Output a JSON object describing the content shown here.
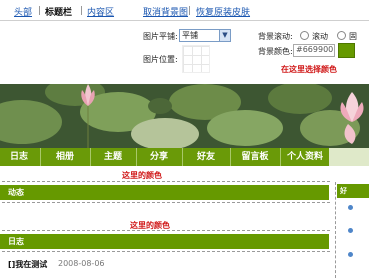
{
  "tabs": [
    {
      "label": "头部"
    },
    {
      "label": "标题栏"
    },
    {
      "label": "内容区"
    }
  ],
  "actions": {
    "cancel_bg": "取消背景图",
    "restore_skin": "恢复原装皮肤"
  },
  "settings": {
    "tile_label": "图片平铺:",
    "tile_value": "平铺",
    "position_label": "图片位置:",
    "scroll_label": "背景滚动:",
    "scroll_opt1": "滚动",
    "scroll_opt2": "固",
    "color_label": "背景颜色:",
    "color_value": "#669900",
    "swatch_color": "#669900"
  },
  "annotations": {
    "pick_color": "在这里选择颜色",
    "here_color_1": "这里的颜色",
    "here_color_2": "这里的颜色"
  },
  "nav": {
    "items": [
      "日志",
      "相册",
      "主题",
      "分享",
      "好友",
      "留言板",
      "个人资料"
    ]
  },
  "sections": {
    "activity": "动态",
    "blog": "日志",
    "side_title": "好"
  },
  "post": {
    "title": "[]我在测试",
    "date": "2008-08-06"
  }
}
